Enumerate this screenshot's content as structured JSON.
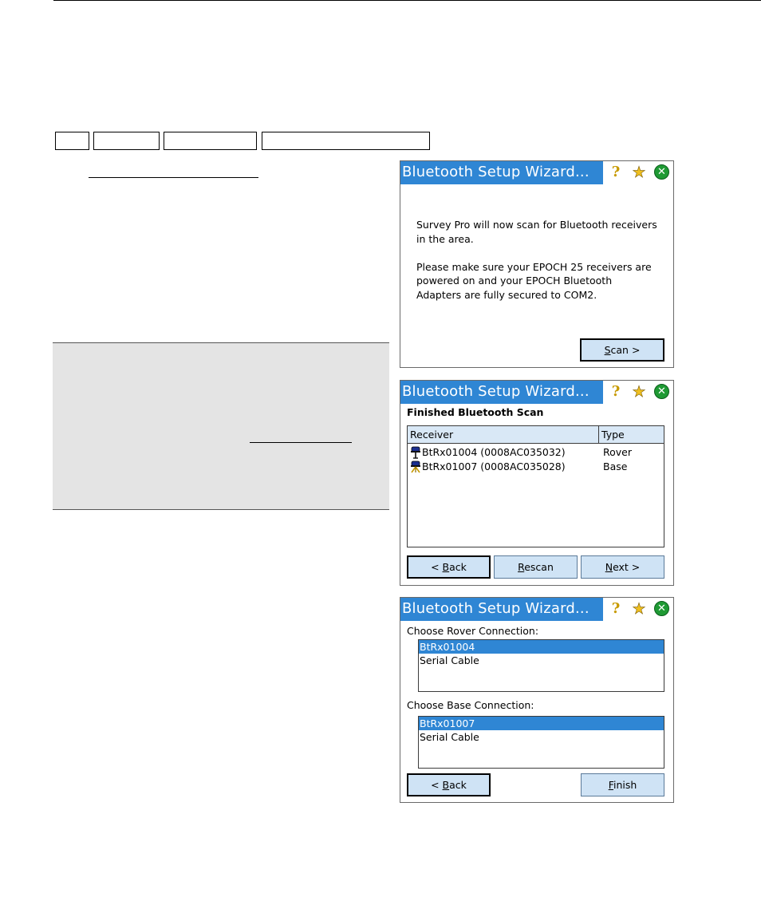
{
  "dialog1": {
    "title": "Bluetooth Setup Wizard...",
    "line1": "Survey Pro will now scan for Bluetooth receivers",
    "line2": "in the area.",
    "line3": "Please make sure your EPOCH 25 receivers are",
    "line4": "powered on and your EPOCH Bluetooth",
    "line5": "Adapters are fully secured to COM2.",
    "scan_accel": "S",
    "scan_rest": "can >"
  },
  "dialog2": {
    "title": "Bluetooth Setup Wizard...",
    "heading": "Finished Bluetooth Scan",
    "columns": [
      "Receiver",
      "Type"
    ],
    "rows": [
      {
        "receiver": "BtRx01004 (0008AC035032)",
        "type": "Rover",
        "icon": "rover-receiver-icon"
      },
      {
        "receiver": "BtRx01007 (0008AC035028)",
        "type": "Base",
        "icon": "base-receiver-icon"
      }
    ],
    "back_pre": "< ",
    "back_accel": "B",
    "back_rest": "ack",
    "rescan_accel": "R",
    "rescan_rest": "escan",
    "next_accel": "N",
    "next_rest": "ext >"
  },
  "dialog3": {
    "title": "Bluetooth Setup Wizard...",
    "rover_label": "Choose Rover Connection:",
    "rover_options": [
      "BtRx01004",
      "Serial Cable"
    ],
    "base_label": "Choose Base Connection:",
    "base_options": [
      "BtRx01007",
      "Serial Cable"
    ],
    "back_pre": "< ",
    "back_accel": "B",
    "back_rest": "ack",
    "finish_accel": "F",
    "finish_rest": "inish"
  },
  "colors": {
    "titlebar": "#2f86d4",
    "button": "#cfe3f5",
    "selection": "#2f86d4",
    "note_bg": "#e4e4e4"
  }
}
